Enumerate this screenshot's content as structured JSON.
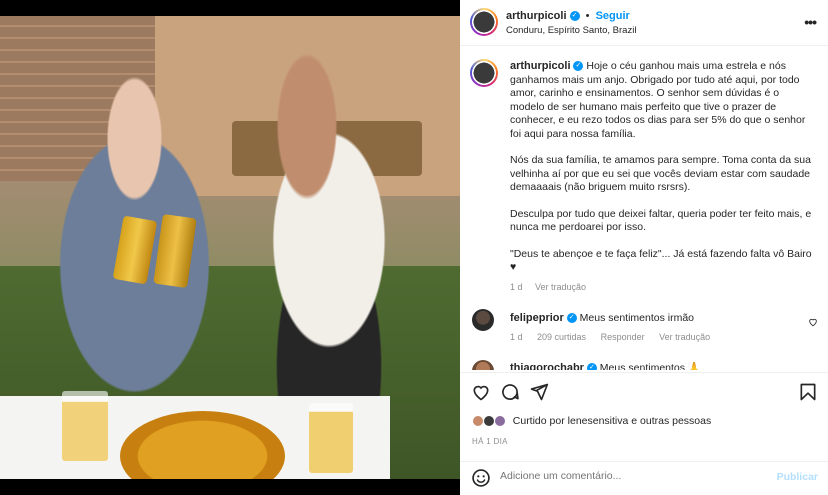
{
  "post": {
    "username": "arthurpicoli",
    "follow_label": "Seguir",
    "location": "Conduru, Espírito Santo, Brazil",
    "caption": {
      "p1": "Hoje o céu ganhou mais uma estrela e nós ganhamos mais um anjo. Obrigado por tudo até aqui, por todo amor, carinho e ensinamentos. O senhor sem dúvidas é o modelo de ser humano mais perfeito que tive o prazer de conhecer, e eu rezo todos os dias para ser 5% do que o senhor foi aqui para nossa família.",
      "p2": "Nós da sua família, te amamos para sempre. Toma conta da sua velhinha aí por que eu sei que vocês deviam estar com saudade demaaaais (não briguem muito rsrsrs).",
      "p3": "Desculpa por tudo que deixei faltar, queria poder ter feito mais, e nunca me perdoarei por isso.",
      "p4": "\"Deus te abençoe e te faça feliz\"... Já está fazendo falta vô Bairo ♥",
      "time": "1 d",
      "translate": "Ver tradução"
    }
  },
  "comments": [
    {
      "username": "felipeprior",
      "text": "Meus sentimentos irmão",
      "time": "1 d",
      "likes": "209 curtidas",
      "reply": "Responder",
      "translate": "Ver tradução"
    },
    {
      "username": "thiagorochabr",
      "text": "Meus sentimentos 🙏"
    }
  ],
  "likes_line": {
    "prefix": "Curtido por",
    "user": "lenesensitiva",
    "suffix": "e outras pessoas"
  },
  "time_ago": "HÁ 1 DIA",
  "add_comment": {
    "placeholder": "Adicione um comentário...",
    "publish": "Publicar"
  },
  "icons": [
    "heart-icon",
    "comment-icon",
    "share-icon",
    "bookmark-icon",
    "emoji-icon",
    "more-icon",
    "verified-icon"
  ],
  "colors": {
    "accent": "#0095f6",
    "muted": "#8e8e8e",
    "publish_disabled": "#b2dffc"
  }
}
